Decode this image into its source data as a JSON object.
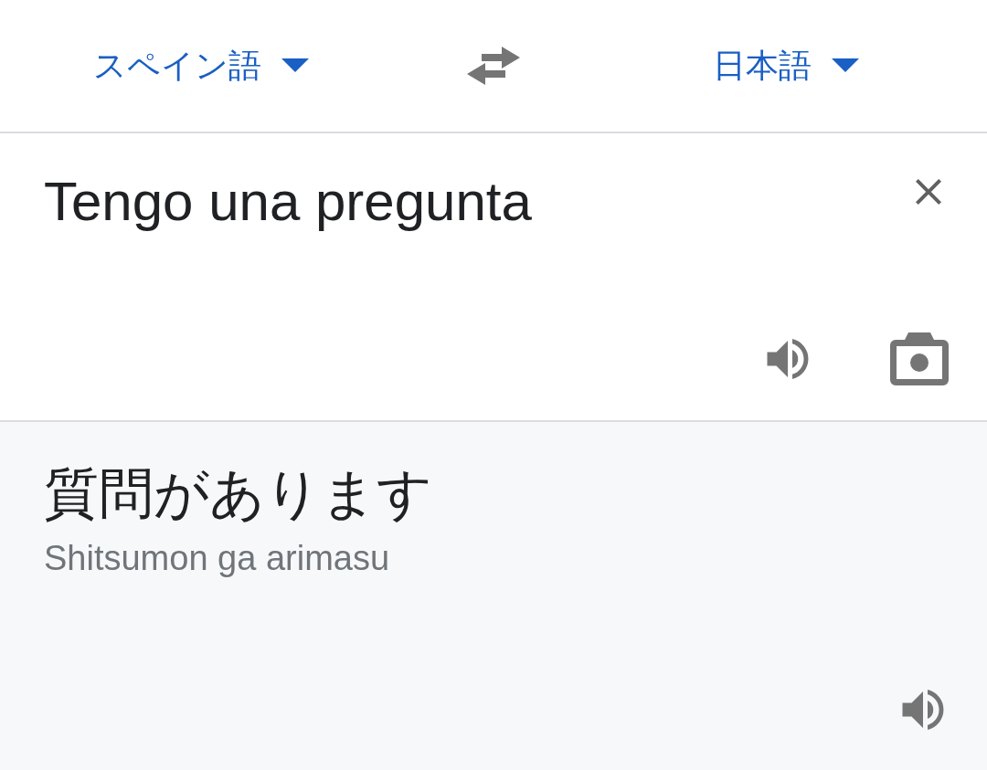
{
  "language_bar": {
    "source": {
      "label": "スペイン語"
    },
    "target": {
      "label": "日本語"
    }
  },
  "input": {
    "value": "Tengo una pregunta"
  },
  "output": {
    "translation": "質問があります",
    "romanization": "Shitsumon ga arimasu"
  }
}
